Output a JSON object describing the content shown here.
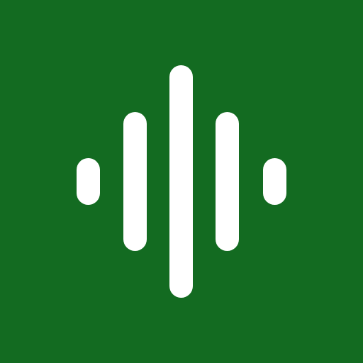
{
  "app_icon": {
    "icon": "audio-waveform-icon",
    "background_color": "#136b21",
    "bar_color": "#ffffff",
    "bars": 5
  }
}
